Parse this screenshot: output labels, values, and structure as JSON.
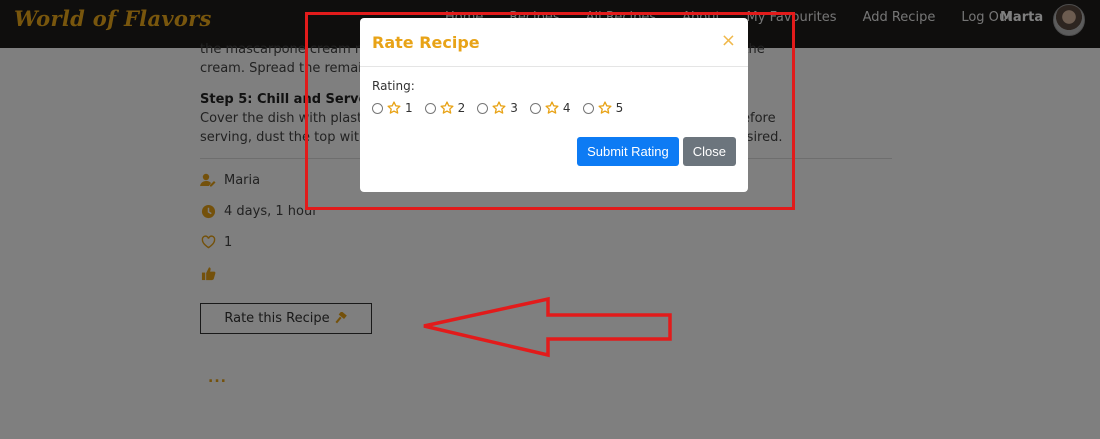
{
  "nav": {
    "brand": "World of Flavors",
    "links": [
      "Home",
      "Recipes",
      "All Recipes",
      "About",
      "My Favourites",
      "Add Recipe",
      "Log Out"
    ],
    "user": "Marta"
  },
  "recipe": {
    "partial_para_1": "the mascarpone cream m                                                                  ngers on top of the",
    "partial_para_2": "cream. Spread the remai                                                                       of ladyfingers.",
    "step5_heading": "Step 5: Chill and Serve",
    "step5_line_1": "Cover the dish with plastic                                                                    results. Just before",
    "step5_line_2": "serving, dust the top with                                                                     shavings, if desired.",
    "author": "Maria",
    "time": "4 days, 1 hour",
    "likes": "1",
    "rate_button_label": "Rate this Recipe",
    "more_dots": "..."
  },
  "modal": {
    "title": "Rate Recipe",
    "close_glyph": "×",
    "rating_label": "Rating:",
    "options": [
      "1",
      "2",
      "3",
      "4",
      "5"
    ],
    "submit_label": "Submit Rating",
    "close_label": "Close"
  },
  "colors": {
    "accent": "#e8a317",
    "navbar_bg": "#1f1c1a",
    "primary": "#0d7bf4",
    "secondary": "#6c757d",
    "annotation": "#e21b1b"
  }
}
